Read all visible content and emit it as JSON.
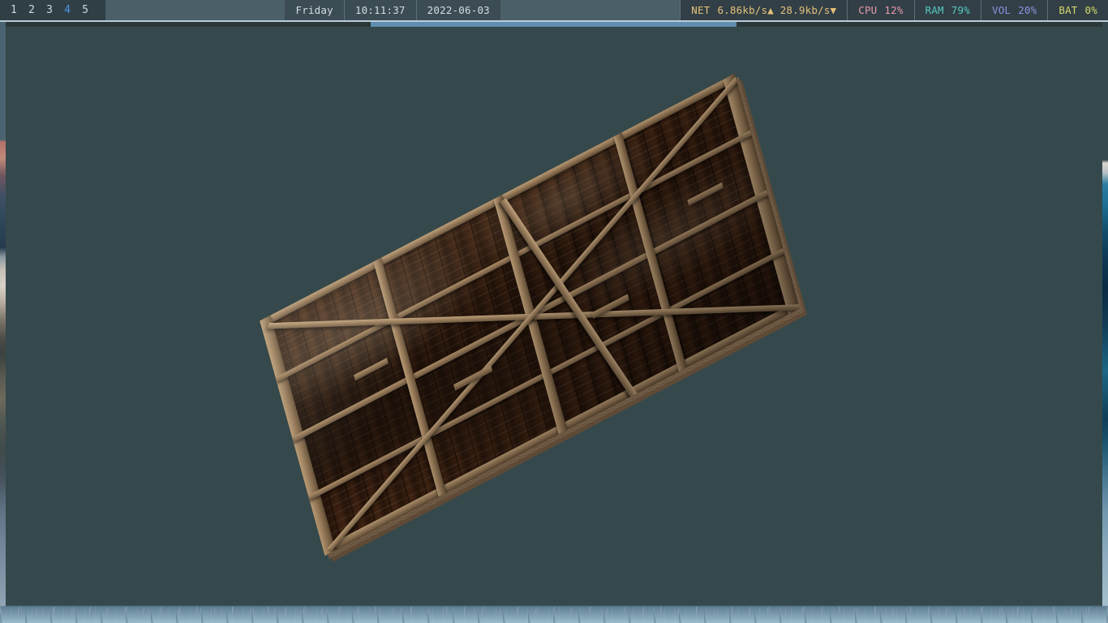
{
  "topbar": {
    "workspaces": [
      {
        "label": "1",
        "active": false
      },
      {
        "label": "2",
        "active": false
      },
      {
        "label": "3",
        "active": false
      },
      {
        "label": "4",
        "active": true
      },
      {
        "label": "5",
        "active": false
      }
    ],
    "clock": {
      "day": "Friday",
      "time": "10:11:37",
      "date": "2022-06-03"
    },
    "modules": [
      {
        "name": "net",
        "label": "NET",
        "value": "6.86kb/s▲ 28.9kb/s▼",
        "color": "#e5c07b"
      },
      {
        "name": "cpu",
        "label": "CPU",
        "value": "12%",
        "color": "#e79aa8"
      },
      {
        "name": "ram",
        "label": "RAM",
        "value": "79%",
        "color": "#56c8bf"
      },
      {
        "name": "vol",
        "label": "VOL",
        "value": "20%",
        "color": "#8a93e0"
      },
      {
        "name": "bat",
        "label": "BAT",
        "value": "0%",
        "color": "#d5d96a"
      }
    ]
  },
  "viewport": {
    "background_color": "#35494c",
    "accent_strip_color": "#5f8eb0",
    "model_name": "wooden-plank-platform"
  }
}
